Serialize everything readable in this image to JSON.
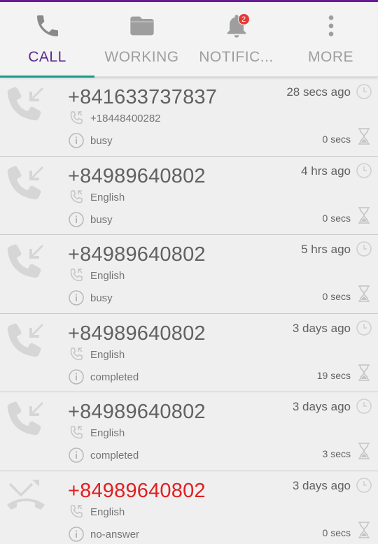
{
  "colors": {
    "accent": "#5e2a8c",
    "indicator": "#1a9b8a",
    "missed": "#e02020",
    "icon_gray": "#cfcfcf"
  },
  "tabs": [
    {
      "label": "CALL",
      "icon": "phone-icon",
      "active": true
    },
    {
      "label": "WORKING",
      "icon": "folder-icon",
      "active": false
    },
    {
      "label": "NOTIFIC...",
      "icon": "bell-icon",
      "active": false,
      "badge": "2"
    },
    {
      "label": "MORE",
      "icon": "more-vert-icon",
      "active": false
    }
  ],
  "calls": [
    {
      "number": "+841633737837",
      "sub": "+18448400282",
      "status": "busy",
      "time": "28 secs ago",
      "duration": "0 secs",
      "type": "incoming",
      "icon": "incoming-call-icon"
    },
    {
      "number": "+84989640802",
      "sub": "English",
      "status": "busy",
      "time": "4 hrs ago",
      "duration": "0 secs",
      "type": "incoming",
      "icon": "incoming-call-icon"
    },
    {
      "number": "+84989640802",
      "sub": "English",
      "status": "busy",
      "time": "5 hrs ago",
      "duration": "0 secs",
      "type": "incoming",
      "icon": "incoming-call-icon"
    },
    {
      "number": "+84989640802",
      "sub": "English",
      "status": "completed",
      "time": "3 days ago",
      "duration": "19 secs",
      "type": "incoming",
      "icon": "incoming-call-icon"
    },
    {
      "number": "+84989640802",
      "sub": "English",
      "status": "completed",
      "time": "3 days ago",
      "duration": "3 secs",
      "type": "incoming",
      "icon": "incoming-call-icon"
    },
    {
      "number": "+84989640802",
      "sub": "English",
      "status": "no-answer",
      "time": "3 days ago",
      "duration": "0 secs",
      "type": "missed",
      "icon": "missed-call-icon"
    }
  ]
}
